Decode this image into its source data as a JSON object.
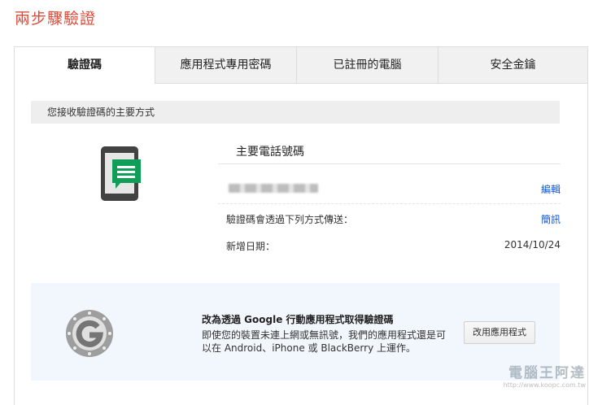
{
  "page": {
    "title": "兩步驟驗證"
  },
  "tabs": [
    {
      "label": "驗證碼",
      "active": true
    },
    {
      "label": "應用程式專用密碼",
      "active": false
    },
    {
      "label": "已註冊的電腦",
      "active": false
    },
    {
      "label": "安全金鑰",
      "active": false
    }
  ],
  "section": {
    "heading": "您接收驗證碼的主要方式"
  },
  "primary": {
    "title": "主要電話號碼",
    "edit_label": "編輯",
    "delivery_label": "驗證碼會透過下列方式傳送：",
    "delivery_value": "簡訊",
    "added_label": "新增日期：",
    "added_value": "2014/10/24"
  },
  "promo": {
    "title": "改為透過 Google 行動應用程式取得驗證碼",
    "text": "即使您的裝置未連上網或無訊號，我們的應用程式還是可以在 Android、iPhone 或 BlackBerry 上運作。",
    "button_label": "改用應用程式"
  },
  "watermark": {
    "main": "電腦王阿達",
    "sub": "http://www.koopc.com.tw"
  },
  "colors": {
    "title_red": "#dd4b39",
    "link_blue": "#1155cc",
    "icon_green": "#0f9d58",
    "promo_bg": "#f2f7fd"
  }
}
